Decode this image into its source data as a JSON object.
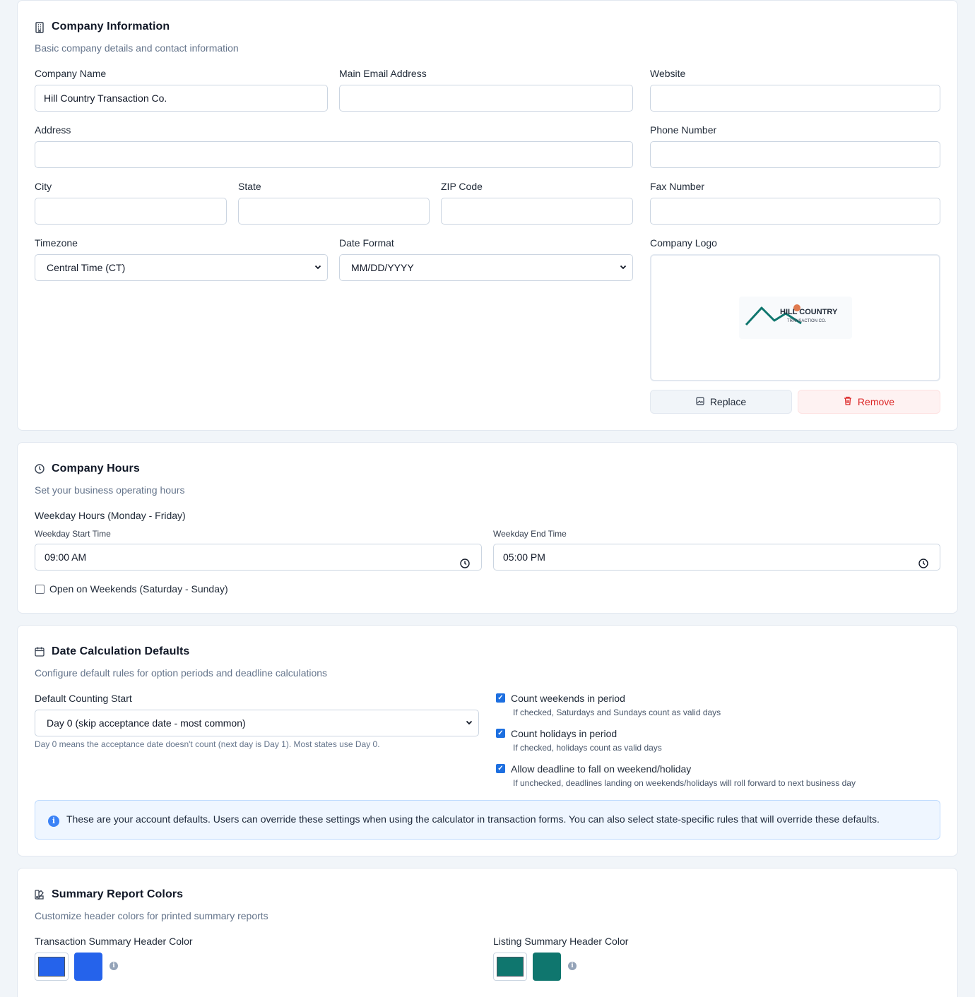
{
  "company_info": {
    "title": "Company Information",
    "subtitle": "Basic company details and contact information",
    "fields": {
      "company_name": {
        "label": "Company Name",
        "value": "Hill Country Transaction Co."
      },
      "main_email": {
        "label": "Main Email Address",
        "value": ""
      },
      "website": {
        "label": "Website",
        "value": ""
      },
      "address": {
        "label": "Address",
        "value": ""
      },
      "phone": {
        "label": "Phone Number",
        "value": ""
      },
      "city": {
        "label": "City",
        "value": ""
      },
      "state": {
        "label": "State",
        "value": ""
      },
      "zip": {
        "label": "ZIP Code",
        "value": ""
      },
      "fax": {
        "label": "Fax Number",
        "value": ""
      },
      "timezone": {
        "label": "Timezone",
        "value": "Central Time (CT)"
      },
      "date_format": {
        "label": "Date Format",
        "value": "MM/DD/YYYY"
      }
    },
    "logo": {
      "label": "Company Logo",
      "logo_text_main": "HILL COUNTRY",
      "logo_text_sub": "TRANSACTION CO.",
      "replace_label": "Replace",
      "remove_label": "Remove"
    }
  },
  "company_hours": {
    "title": "Company Hours",
    "subtitle": "Set your business operating hours",
    "weekday_heading": "Weekday Hours (Monday - Friday)",
    "start_label": "Weekday Start Time",
    "start_value": "09:00 AM",
    "end_label": "Weekday End Time",
    "end_value": "05:00 PM",
    "weekends_label": "Open on Weekends (Saturday - Sunday)",
    "weekends_checked": false
  },
  "date_calc": {
    "title": "Date Calculation Defaults",
    "subtitle": "Configure default rules for option periods and deadline calculations",
    "counting_start_label": "Default Counting Start",
    "counting_start_value": "Day 0 (skip acceptance date - most common)",
    "counting_start_help": "Day 0 means the acceptance date doesn't count (next day is Day 1). Most states use Day 0.",
    "options": [
      {
        "label": "Count weekends in period",
        "help": "If checked, Saturdays and Sundays count as valid days",
        "checked": true
      },
      {
        "label": "Count holidays in period",
        "help": "If checked, holidays count as valid days",
        "checked": true
      },
      {
        "label": "Allow deadline to fall on weekend/holiday",
        "help": "If unchecked, deadlines landing on weekends/holidays will roll forward to next business day",
        "checked": true
      }
    ],
    "info_text": "These are your account defaults. Users can override these settings when using the calculator in transaction forms. You can also select state-specific rules that will override these defaults."
  },
  "report_colors": {
    "title": "Summary Report Colors",
    "subtitle": "Customize header colors for printed summary reports",
    "transaction_label": "Transaction Summary Header Color",
    "transaction_color": "#2563eb",
    "listing_label": "Listing Summary Header Color",
    "listing_color": "#0f766e"
  },
  "colors": {
    "accent": "#1d6fe0",
    "danger": "#dc2626",
    "logo_teal": "#0f766e",
    "logo_sun": "#e07a4f"
  }
}
